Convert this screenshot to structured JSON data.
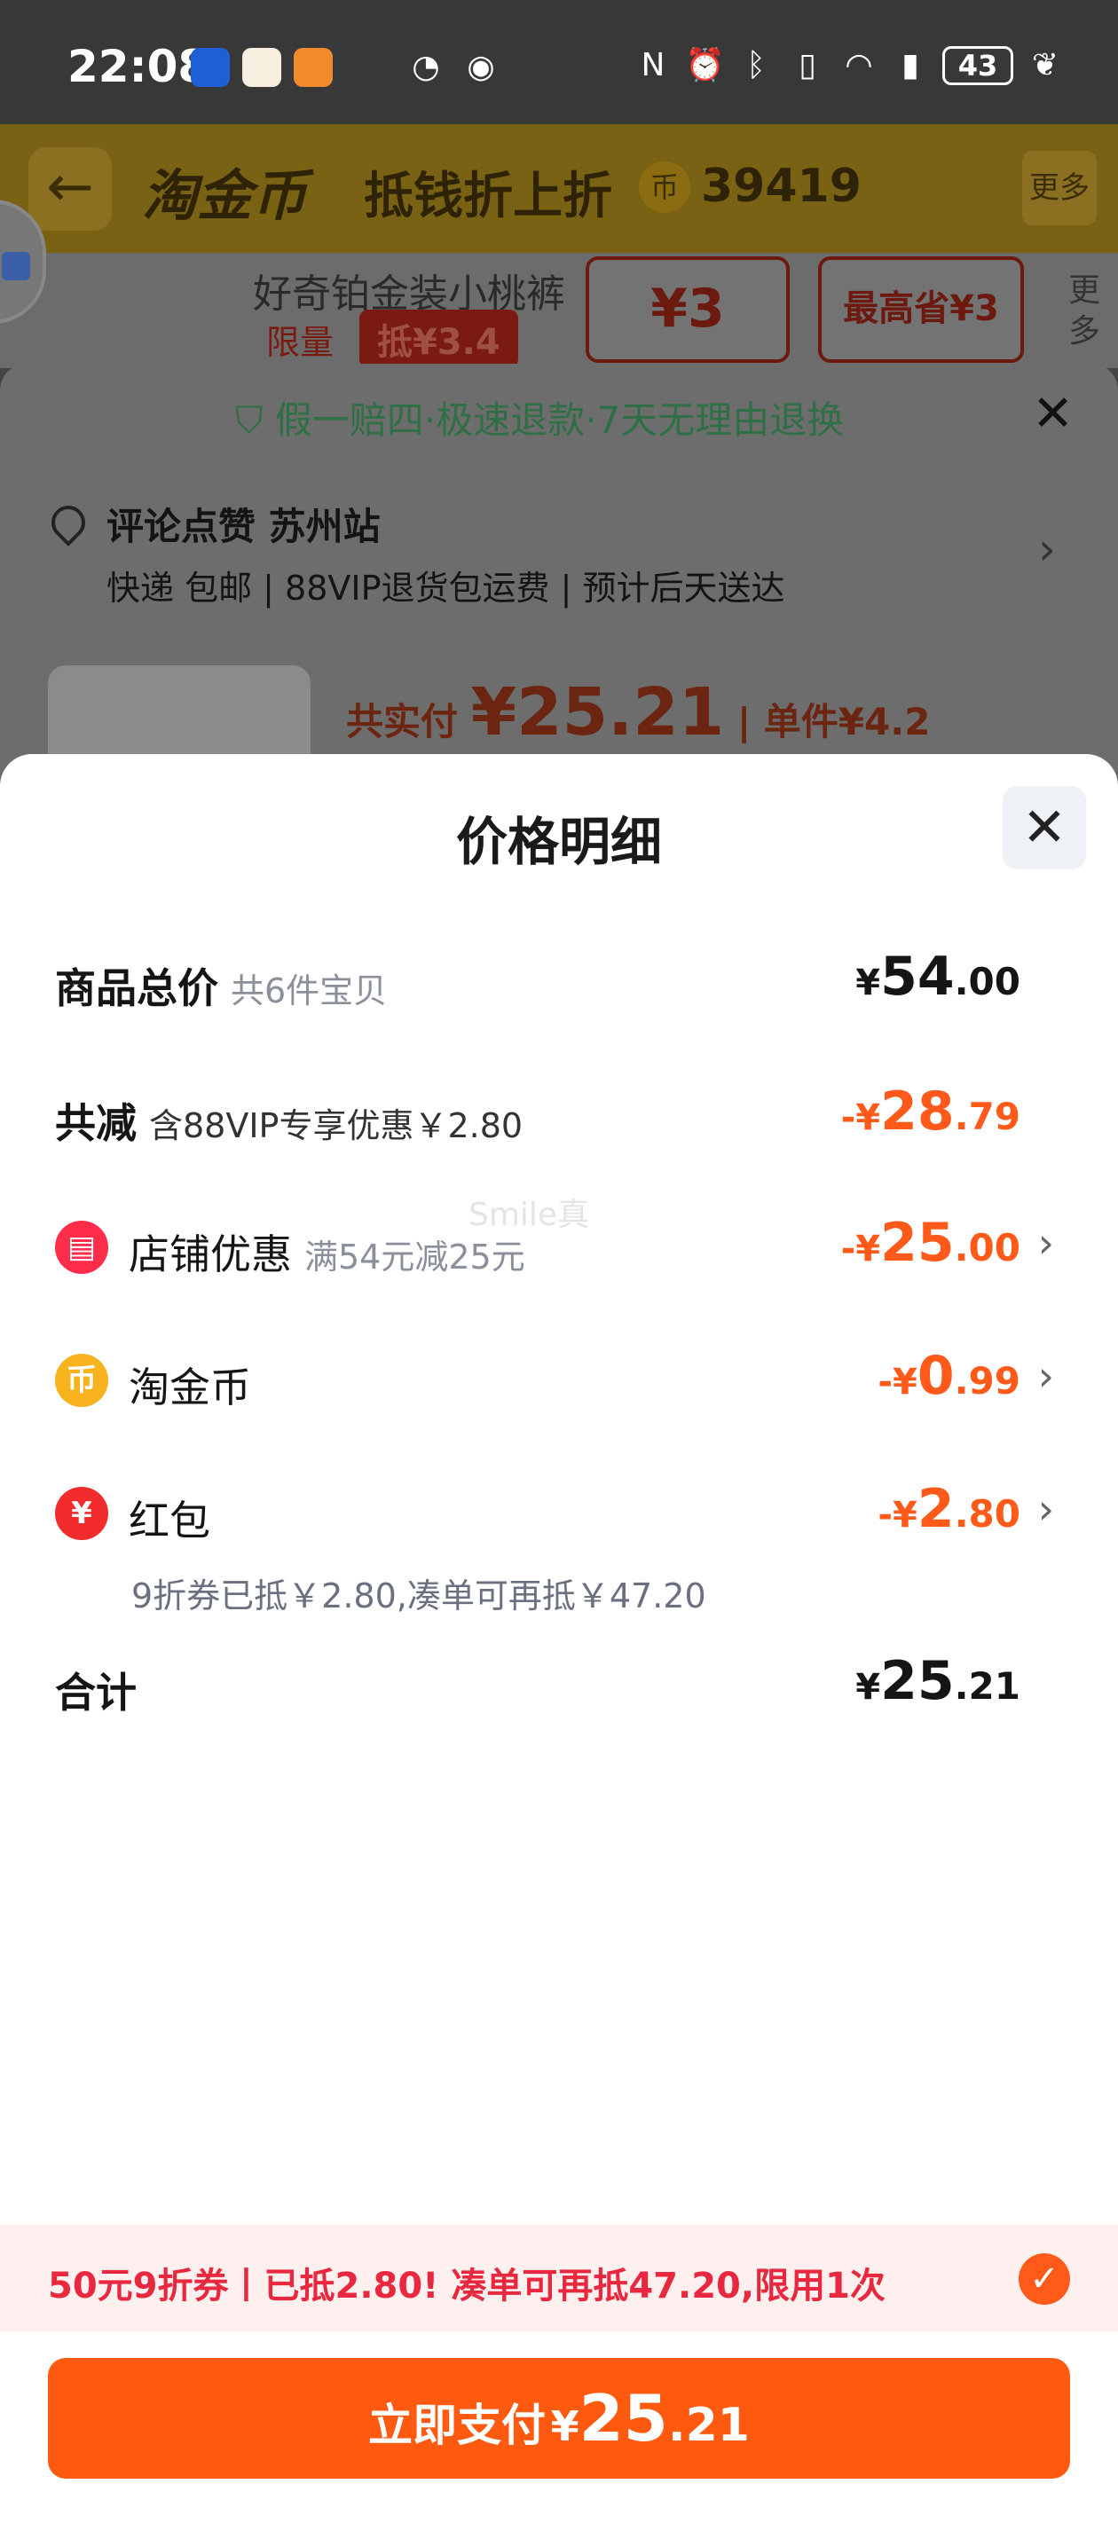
{
  "status_bar": {
    "time": "22:08",
    "battery": "43",
    "icons": [
      "nfc-icon",
      "alarm-icon",
      "bluetooth-icon",
      "vibrate-icon",
      "wifi-icon",
      "signal-icon",
      "leaf-icon"
    ]
  },
  "background_page": {
    "header_title": "淘金币",
    "header_subtitle": "抵钱折上折",
    "coin_count": "39419",
    "more_label": "更多",
    "product_name": "好奇铂金装小桃裤",
    "limit_label": "限量",
    "deduct_badge": "抵¥3.4",
    "price_box_1": "¥3",
    "price_box_2": "最高省¥3",
    "more_side": "更多",
    "guarantee": "假一赔四·极速退款·7天无理由退换",
    "address": "评论点赞 苏州站",
    "shipping": "快递 包邮 | 88VIP退货包运费 | 预计后天送达",
    "total_label": "共实付",
    "total_value": "¥25.21",
    "unit_label": "| 单件¥4.2"
  },
  "sheet": {
    "title": "价格明细",
    "rows": {
      "total_price": {
        "label": "商品总价",
        "note": "共6件宝贝",
        "cur": "¥",
        "int": "54",
        "dec": ".00"
      },
      "discount": {
        "label": "共减",
        "note": "含88VIP专享优惠￥2.80",
        "cur": "-¥",
        "int": "28",
        "dec": ".79"
      },
      "shop": {
        "label": "店铺优惠",
        "note": "满54元减25元",
        "cur": "-¥",
        "int": "25",
        "dec": ".00"
      },
      "coins": {
        "label": "淘金币",
        "cur": "-¥",
        "int": "0",
        "dec": ".99"
      },
      "redpacket": {
        "label": "红包",
        "sub": "9折券已抵￥2.80,凑单可再抵￥47.20",
        "cur": "-¥",
        "int": "2",
        "dec": ".80"
      },
      "sum": {
        "label": "合计",
        "cur": "¥",
        "int": "25",
        "dec": ".21"
      }
    },
    "watermark": "Smile真"
  },
  "promo": {
    "text": "50元9折券丨已抵2.80! 凑单可再抵47.20,限用1次"
  },
  "pay_button": {
    "label": "立即支付",
    "cur": "¥",
    "int": "25",
    "dec": ".21"
  },
  "colors": {
    "accent_orange": "#ff5a1a",
    "promo_red": "#e8283e",
    "promo_bg": "#fff0f0"
  }
}
